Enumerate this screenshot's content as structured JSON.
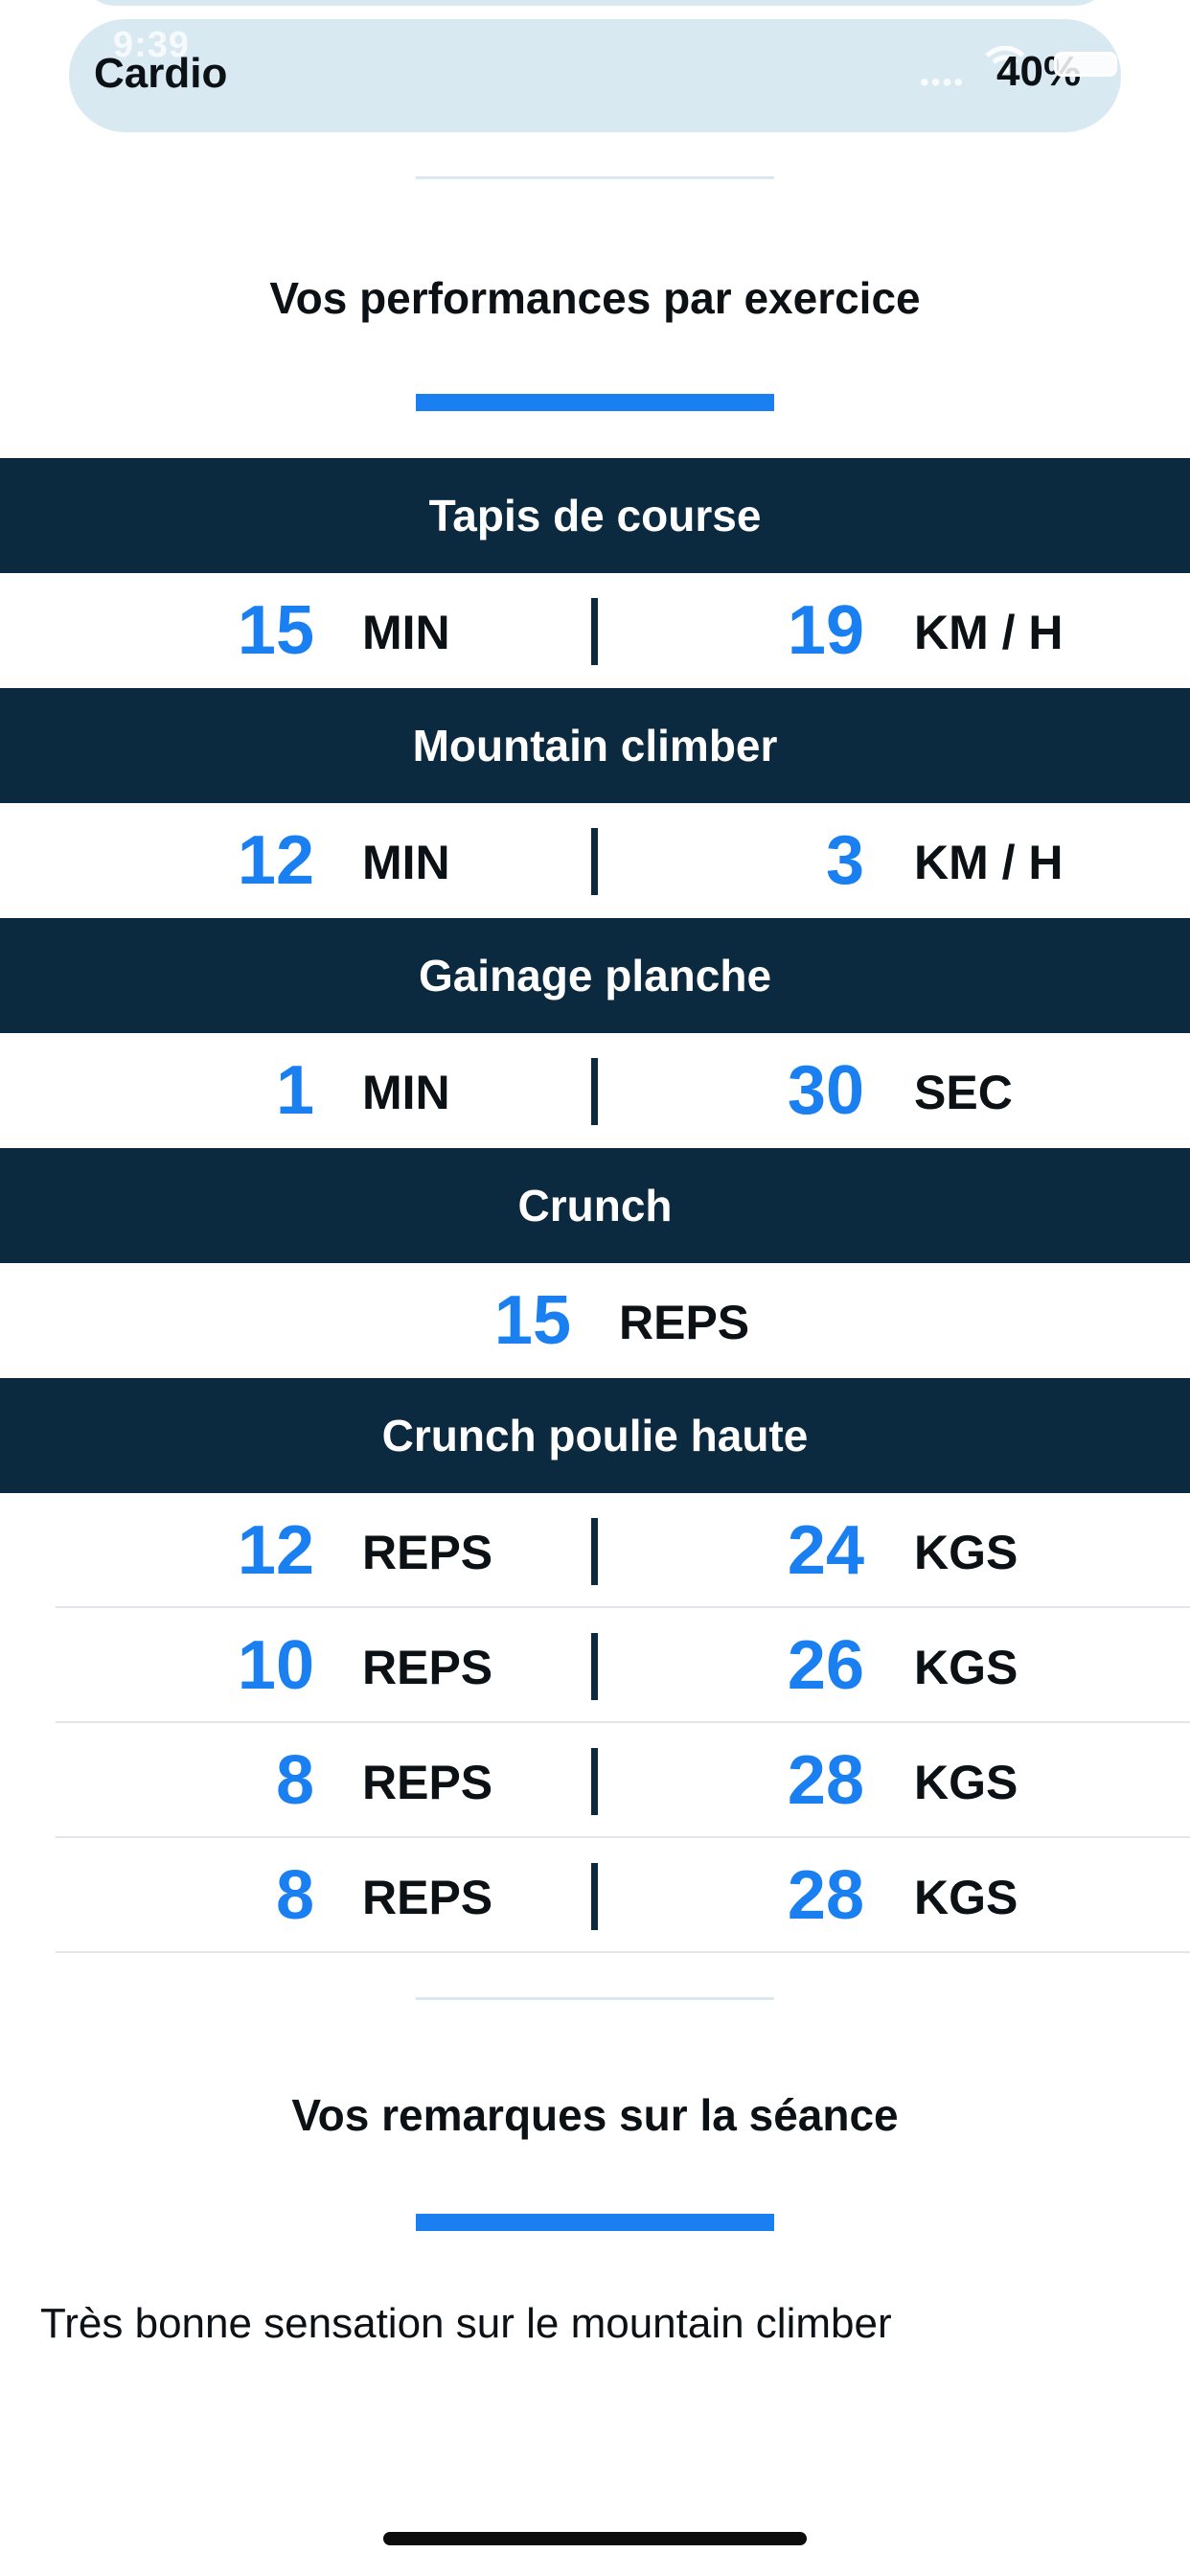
{
  "status_bar": {
    "time": "9:39",
    "battery": "40%"
  },
  "header": {
    "title": "Cardio"
  },
  "performance": {
    "title": "Vos performances par exercice",
    "exercises": [
      {
        "name": "Tapis de course",
        "rows": [
          {
            "left_value": "15",
            "left_unit": "MIN",
            "right_value": "19",
            "right_unit": "KM / H"
          }
        ]
      },
      {
        "name": "Mountain climber",
        "rows": [
          {
            "left_value": "12",
            "left_unit": "MIN",
            "right_value": "3",
            "right_unit": "KM / H"
          }
        ]
      },
      {
        "name": "Gainage planche",
        "rows": [
          {
            "left_value": "1",
            "left_unit": "MIN",
            "right_value": "30",
            "right_unit": "SEC"
          }
        ]
      },
      {
        "name": "Crunch",
        "rows": [
          {
            "value": "15",
            "unit": "REPS"
          }
        ]
      },
      {
        "name": "Crunch poulie haute",
        "rows": [
          {
            "left_value": "12",
            "left_unit": "REPS",
            "right_value": "24",
            "right_unit": "KGS"
          },
          {
            "left_value": "10",
            "left_unit": "REPS",
            "right_value": "26",
            "right_unit": "KGS"
          },
          {
            "left_value": "8",
            "left_unit": "REPS",
            "right_value": "28",
            "right_unit": "KGS"
          },
          {
            "left_value": "8",
            "left_unit": "REPS",
            "right_value": "28",
            "right_unit": "KGS"
          }
        ]
      }
    ]
  },
  "remarks": {
    "title": "Vos remarques sur la séance",
    "text": "Très bonne sensation sur le mountain climber"
  },
  "colors": {
    "accent": "#1a7ff0",
    "header_bg": "#0b2a3f",
    "pill_bg": "#d9e9f2"
  }
}
